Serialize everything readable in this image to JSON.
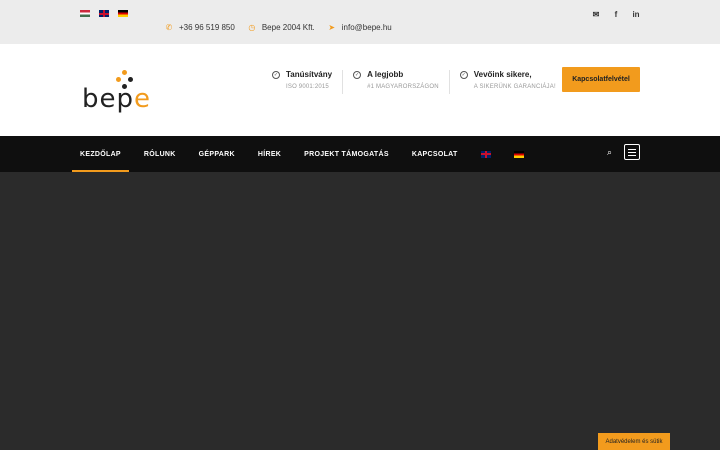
{
  "topbar": {
    "languages": [
      "hu",
      "en",
      "de"
    ],
    "phone": "+36 96 519 850",
    "company": "Bepe 2004 Kft.",
    "email": "info@bepe.hu",
    "socials": [
      "envelope-icon",
      "facebook-icon",
      "linkedin-icon"
    ]
  },
  "header": {
    "logo_text_a": "bep",
    "logo_text_b": "e",
    "features": [
      {
        "title": "Tanúsítvány",
        "sub": "ISO 9001:2015"
      },
      {
        "title": "A legjobb",
        "sub": "#1 MAGYARORSZÁGON"
      },
      {
        "title": "Vevőink sikere,",
        "sub": "A SIKERÜNK GARANCIÁJA!"
      }
    ],
    "cta_label": "Kapcsolatfelvétel"
  },
  "nav": {
    "items": [
      "KEZDŐLAP",
      "RÓLUNK",
      "GÉPPARK",
      "HÍREK",
      "PROJEKT TÁMOGATÁS",
      "KAPCSOLAT"
    ],
    "active": "KEZDŐLAP"
  },
  "cookie": {
    "label": "Adatvédelem és sütik"
  },
  "colors": {
    "accent": "#f29b1d",
    "nav_bg": "#0f0f0f",
    "hero_bg": "#2b2b2b",
    "topbar_bg": "#ececec"
  }
}
